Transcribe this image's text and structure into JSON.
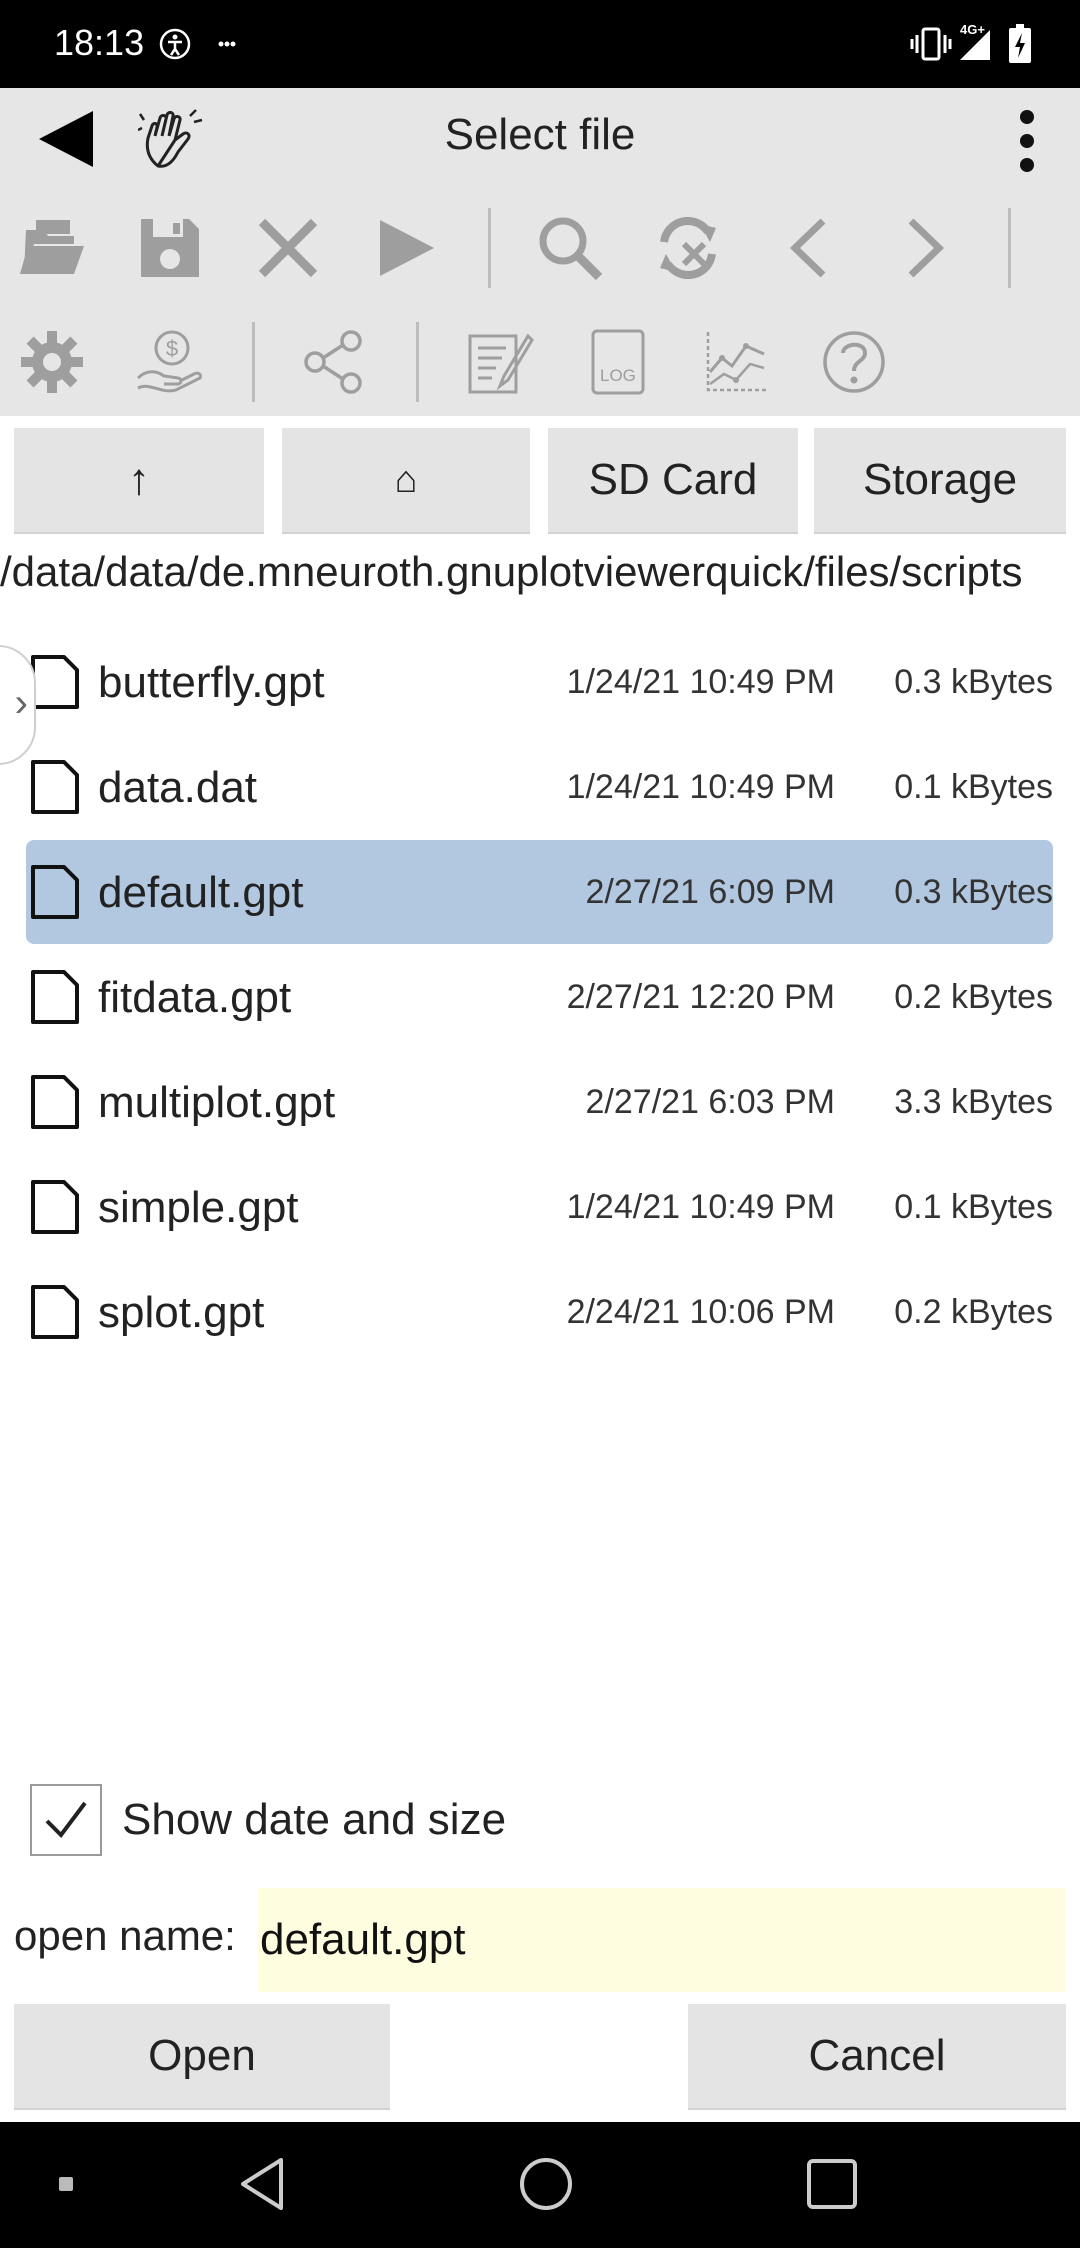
{
  "status_bar": {
    "time": "18:13",
    "icons": [
      "accessibility-icon",
      "more-dots-icon",
      "vibrate-icon",
      "signal-4g-icon",
      "battery-charging-icon"
    ],
    "network_label": "4G+"
  },
  "title_bar": {
    "title": "Select file",
    "icons": [
      "back-arrow-icon",
      "hand-wave-icon",
      "overflow-menu-icon"
    ]
  },
  "toolbar_row1": {
    "icons": [
      "open-folder-icon",
      "save-icon",
      "close-x-icon",
      "run-play-icon",
      "search-icon",
      "refresh-icon",
      "previous-icon",
      "next-icon"
    ]
  },
  "toolbar_row2": {
    "icons": [
      "settings-gear-icon",
      "donate-icon",
      "share-icon",
      "edit-notes-icon",
      "log-icon",
      "plot-chart-icon",
      "help-icon"
    ],
    "log_text": "LOG"
  },
  "nav_buttons": {
    "up": "↑",
    "home": "⌂",
    "sdcard": "SD Card",
    "storage": "Storage"
  },
  "path": "/data/data/de.mneuroth.gnuplotviewerquick/files/scripts",
  "files": [
    {
      "name": "butterfly.gpt",
      "date": "1/24/21 10:49 PM",
      "size": "0.3 kBytes",
      "selected": false
    },
    {
      "name": "data.dat",
      "date": "1/24/21 10:49 PM",
      "size": "0.1 kBytes",
      "selected": false
    },
    {
      "name": "default.gpt",
      "date": "2/27/21 6:09 PM",
      "size": "0.3 kBytes",
      "selected": true
    },
    {
      "name": "fitdata.gpt",
      "date": "2/27/21 12:20 PM",
      "size": "0.2 kBytes",
      "selected": false
    },
    {
      "name": "multiplot.gpt",
      "date": "2/27/21 6:03 PM",
      "size": "3.3 kBytes",
      "selected": false
    },
    {
      "name": "simple.gpt",
      "date": "1/24/21 10:49 PM",
      "size": "0.1 kBytes",
      "selected": false
    },
    {
      "name": "splot.gpt",
      "date": "2/24/21 10:06 PM",
      "size": "0.2 kBytes",
      "selected": false
    }
  ],
  "options": {
    "show_date_size_label": "Show date and size",
    "show_date_size_checked": true
  },
  "open_name": {
    "label": "open name:",
    "value": "default.gpt"
  },
  "actions": {
    "open": "Open",
    "cancel": "Cancel"
  },
  "colors": {
    "toolbar_bg": "#e6e6e6",
    "selected_row": "#b2c7e0",
    "input_bg": "#fffde0",
    "icon_gray": "#9e9e9e"
  }
}
